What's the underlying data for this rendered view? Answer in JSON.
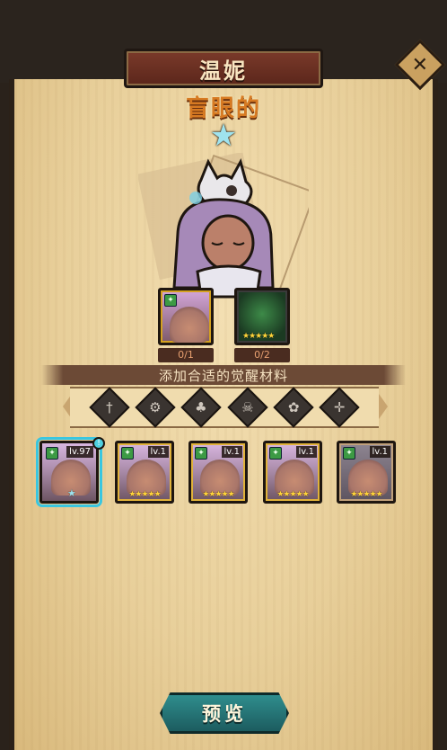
{
  "header": {
    "title": "温妮",
    "close_icon": "close-icon"
  },
  "hero": {
    "trait": "盲眼的",
    "star_count": 1,
    "star_color": "#9fe3ee"
  },
  "materials": [
    {
      "name": "portrait-material",
      "count": "0/1"
    },
    {
      "name": "hooded-material",
      "count": "0/2",
      "stars": "★★★★★"
    }
  ],
  "banner": {
    "text": "添加合适的觉醒材料"
  },
  "slot_icons": [
    "sword-icon",
    "gear-icon",
    "clover-icon",
    "skull-icon",
    "flower-icon",
    "crosshair-icon"
  ],
  "cards": [
    {
      "level": "lv.97",
      "stars": "★",
      "selected": true,
      "badge": "!"
    },
    {
      "level": "lv.1",
      "stars": "★★★★★"
    },
    {
      "level": "lv.1",
      "stars": "★★★★★"
    },
    {
      "level": "lv.1",
      "stars": "★★★★★"
    },
    {
      "level": "lv.1",
      "stars": "★★★★★"
    }
  ],
  "footer": {
    "preview_label": "预览"
  },
  "colors": {
    "accent_teal": "#2f8d8d",
    "trait_orange": "#d77a22",
    "title_plate": "#6b2f22"
  }
}
